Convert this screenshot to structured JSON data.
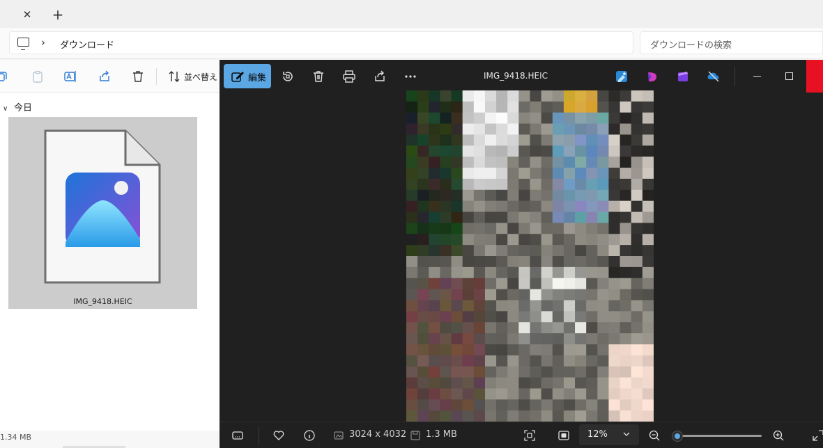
{
  "explorer": {
    "tab_close": "✕",
    "tab_add": "+",
    "breadcrumb": {
      "chevron": "›",
      "folder": "ダウンロード"
    },
    "search_placeholder": "ダウンロードの検索",
    "toolbar": {
      "sort_label": "並べ替え"
    },
    "group": {
      "chevron": "∨",
      "label": "今日"
    },
    "file": {
      "name": "IMG_9418.HEIC",
      "icon": "photos-app-icon"
    },
    "status": {
      "selected_size": "1.34 MB"
    }
  },
  "viewer": {
    "edit_label": "編集",
    "title": "IMG_9418.HEIC",
    "metadata": {
      "dimensions": "3024 x 4032",
      "file_size": "1.3 MB"
    },
    "zoom": {
      "value": "12%",
      "level": 0.0
    },
    "colors": {
      "accent": "#5aa7e4",
      "close_hover": "#e81123",
      "background": "#202020"
    }
  }
}
